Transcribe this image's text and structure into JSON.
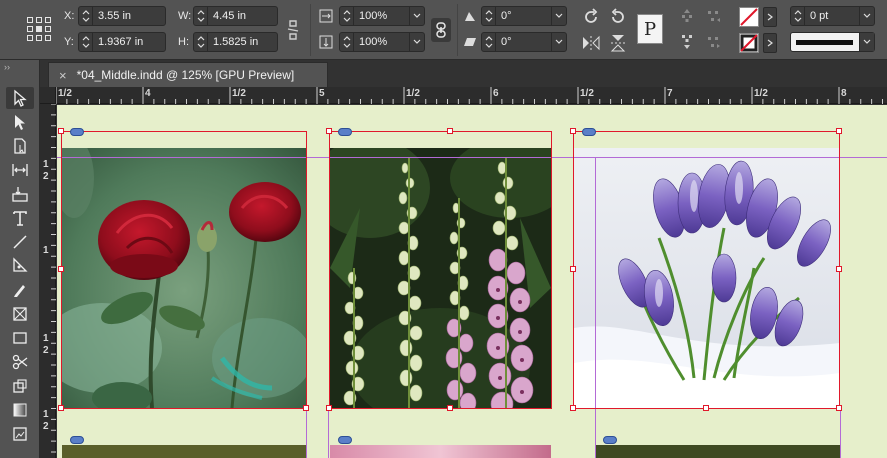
{
  "control_bar": {
    "x_label": "X:",
    "x_value": "3.55 in",
    "y_label": "Y:",
    "y_value": "1.9367 in",
    "w_label": "W:",
    "w_value": "4.45 in",
    "h_label": "H:",
    "h_value": "1.5825 in",
    "scale_x": "100%",
    "scale_y": "100%",
    "rotation": "0°",
    "shear": "0°",
    "stroke_weight": "0 pt"
  },
  "document_tab": {
    "title": "*04_Middle.indd @ 125% [GPU Preview]",
    "close_glyph": "×"
  },
  "tools_collapse": "››",
  "tools": [
    "selection-tool",
    "direct-selection-tool",
    "page-tool",
    "gap-tool",
    "content-collector-tool",
    "type-tool",
    "line-tool",
    "pen-tool",
    "pencil-tool",
    "rectangle-frame-tool",
    "rectangle-tool",
    "scissors-tool",
    "free-transform-tool",
    "gradient-swatch-tool",
    "note-tool"
  ],
  "horizontal_ruler": [
    "1/2",
    "4",
    "1/2",
    "5",
    "1/2",
    "6",
    "1/2",
    "7",
    "1/2",
    "8"
  ],
  "vertical_ruler": [
    "1",
    "2",
    "1",
    "1",
    "2",
    "1",
    "2"
  ],
  "colors": {
    "pasteboard": "#e6efcb",
    "frame_selection": "#e0182b",
    "guide": "#b36ad6",
    "ui_panel": "#535353"
  }
}
